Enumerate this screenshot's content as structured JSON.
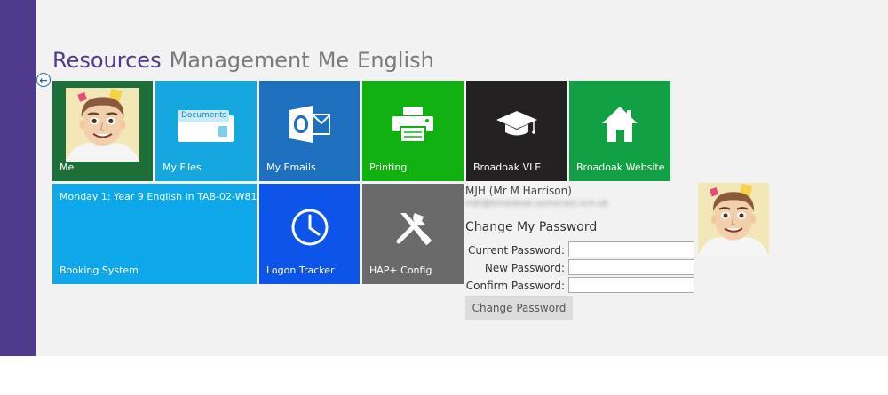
{
  "tabs": [
    {
      "label": "Resources",
      "active": true
    },
    {
      "label": "Management",
      "active": false
    },
    {
      "label": "Me",
      "active": false
    },
    {
      "label": "English",
      "active": false
    }
  ],
  "tiles": {
    "me": {
      "label": "Me",
      "color": "#1e6e3a"
    },
    "my_files": {
      "label": "My Files",
      "icon_text": "Documents",
      "color": "#14a8df"
    },
    "my_emails": {
      "label": "My Emails",
      "color": "#1f6fbf"
    },
    "printing": {
      "label": "Printing",
      "color": "#12b112"
    },
    "vle": {
      "label": "Broadoak VLE",
      "color": "#242122"
    },
    "website": {
      "label": "Broadoak Website",
      "color": "#11a043"
    },
    "booking": {
      "top_text": "Monday 1: Year 9 English in TAB-02-W81",
      "label": "Booking System",
      "color": "#0ea7ea"
    },
    "logon": {
      "label": "Logon Tracker",
      "color": "#0d55e8"
    },
    "hap": {
      "label": "HAP+ Config",
      "color": "#6a6a6a"
    }
  },
  "profile": {
    "name": "MJH (Mr M Harrison)",
    "email": "mjh@broadoak.somerset.sch.uk",
    "heading": "Change My Password",
    "fields": {
      "current": {
        "label": "Current Password:",
        "value": ""
      },
      "new": {
        "label": "New Password:",
        "value": ""
      },
      "confirm": {
        "label": "Confirm Password:",
        "value": ""
      }
    },
    "button_label": "Change Password"
  }
}
